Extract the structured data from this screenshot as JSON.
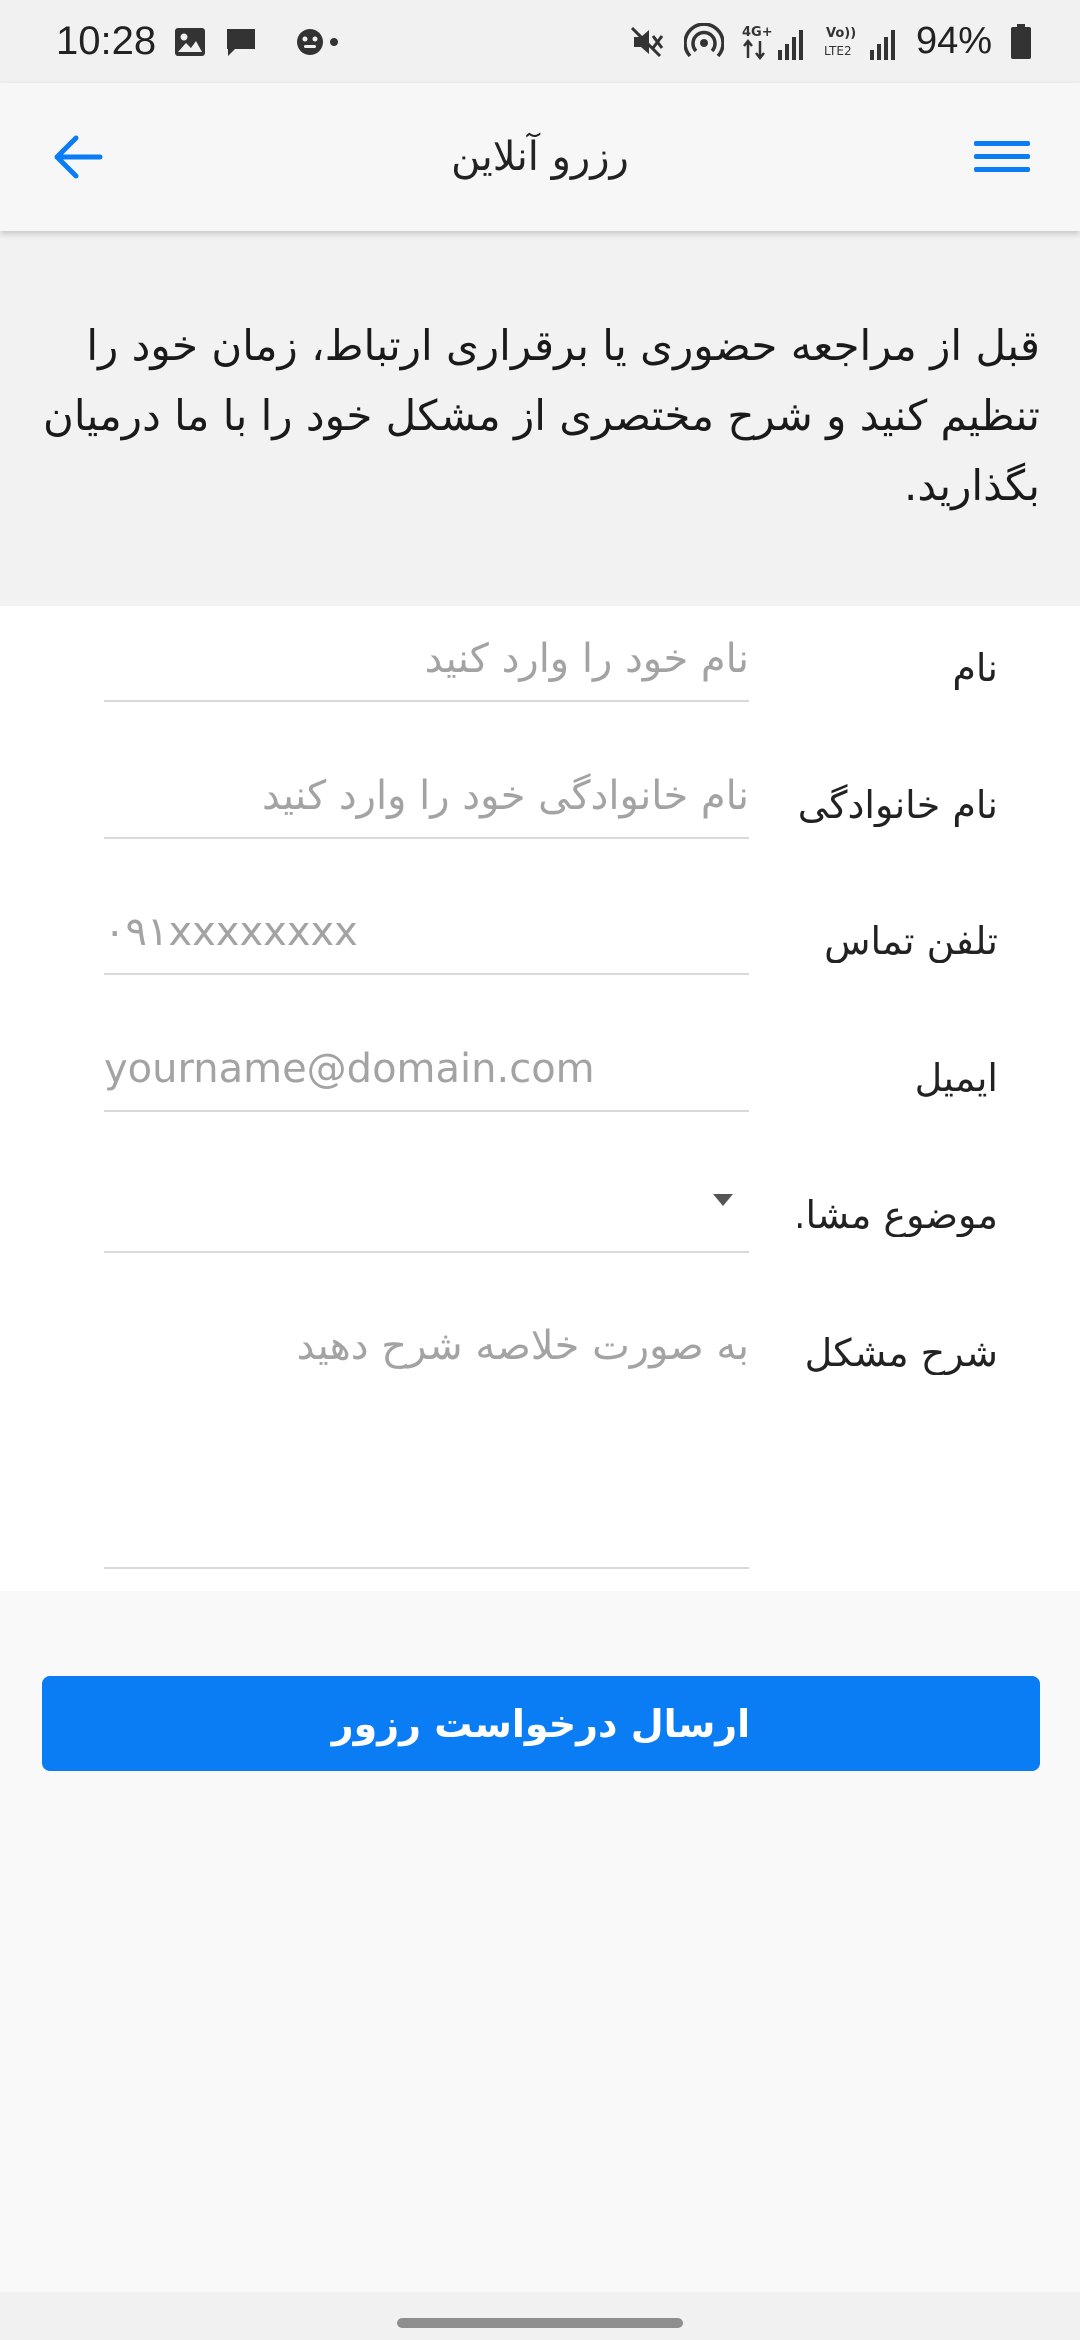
{
  "status_bar": {
    "time": "10:28",
    "battery": "94%",
    "icons": [
      "gallery-icon",
      "message-icon",
      "assistant-icon",
      "mute-icon",
      "hotspot-icon",
      "signal-4g-icon",
      "volte-signal-icon",
      "battery-icon"
    ]
  },
  "app_bar": {
    "title": "رزرو آنلاین",
    "back_icon": "arrow-left-icon",
    "menu_icon": "hamburger-menu-icon",
    "accent": "#0a7cf4"
  },
  "intro": {
    "text": "قبل از مراجعه حضوری یا برقراری ارتباط، زمان خود را تنظیم کنید و شرح مختصری از مشکل خود را با ما درمیان بگذارید."
  },
  "form": {
    "first_name": {
      "label": "نام",
      "placeholder": "نام خود را وارد کنید",
      "value": ""
    },
    "last_name": {
      "label": "نام خانوادگی",
      "placeholder": "نام خانوادگی خود را وارد کنید",
      "value": ""
    },
    "phone": {
      "label": "تلفن تماس",
      "placeholder": "۰۹۱xxxxxxxx",
      "value": ""
    },
    "email": {
      "label": "ایمیل",
      "placeholder": "yourname@domain.com",
      "value": ""
    },
    "subject": {
      "label": "موضوع مشا...",
      "selected": ""
    },
    "description": {
      "label": "شرح مشکل",
      "placeholder": "به صورت خلاصه شرح دهید",
      "value": ""
    }
  },
  "submit": {
    "label": "ارسال درخواست رزور"
  },
  "colors": {
    "primary": "#0a7cf4",
    "background": "#f9f9f9",
    "divider": "#d9d9d9"
  }
}
